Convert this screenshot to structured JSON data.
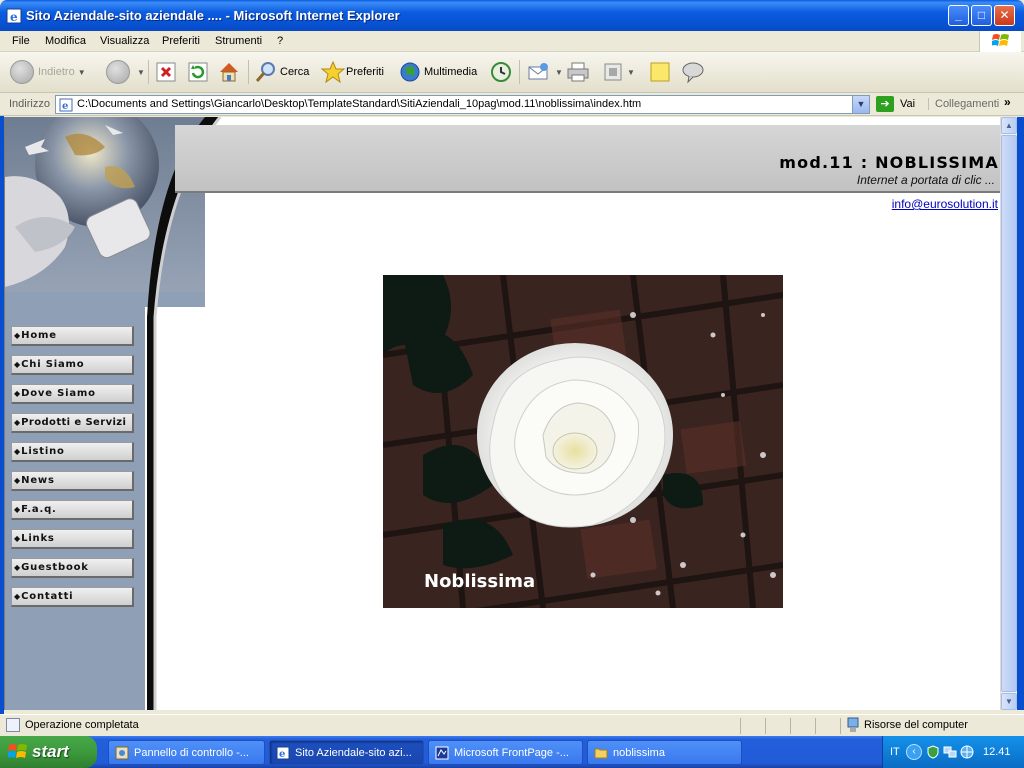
{
  "window": {
    "title": "Sito Aziendale-sito aziendale .... - Microsoft Internet Explorer",
    "minimize": "_",
    "maximize": "□",
    "close": "✕"
  },
  "menu": [
    "File",
    "Modifica",
    "Visualizza",
    "Preferiti",
    "Strumenti",
    "?"
  ],
  "toolbar": {
    "back": "Indietro",
    "search": "Cerca",
    "favorites": "Preferiti",
    "media": "Multimedia"
  },
  "address": {
    "label": "Indirizzo",
    "url": "C:\\Documents and Settings\\Giancarlo\\Desktop\\TemplateStandard\\SitiAziendali_10pag\\mod.11\\noblissima\\index.htm",
    "go": "Vai",
    "links": "Collegamenti",
    "more": "»"
  },
  "page": {
    "title": "mod.11  :  NOBLISSIMA",
    "subtitle": "Internet a portata di clic ...",
    "email": "info@eurosolution.it",
    "image_caption": "Noblissima",
    "nav": [
      "Home",
      "Chi Siamo",
      "Dove Siamo",
      "Prodotti e Servizi",
      "Listino",
      "News",
      "F.a.q.",
      "Links",
      "Guestbook",
      "Contatti"
    ]
  },
  "status": {
    "text": "Operazione completata",
    "zone": "Risorse del computer"
  },
  "taskbar": {
    "start": "start",
    "tasks": [
      "Pannello di controllo -...",
      "Sito Aziendale-sito azi...",
      "Microsoft FrontPage -...",
      "noblissima"
    ],
    "lang": "IT",
    "clock": "12.41"
  },
  "colors": {
    "titlebar": "#0a5be0",
    "sidebar": "#8fa0b6",
    "link": "#0000c0",
    "taskbar": "#245edb",
    "start": "#3c9a3c"
  }
}
